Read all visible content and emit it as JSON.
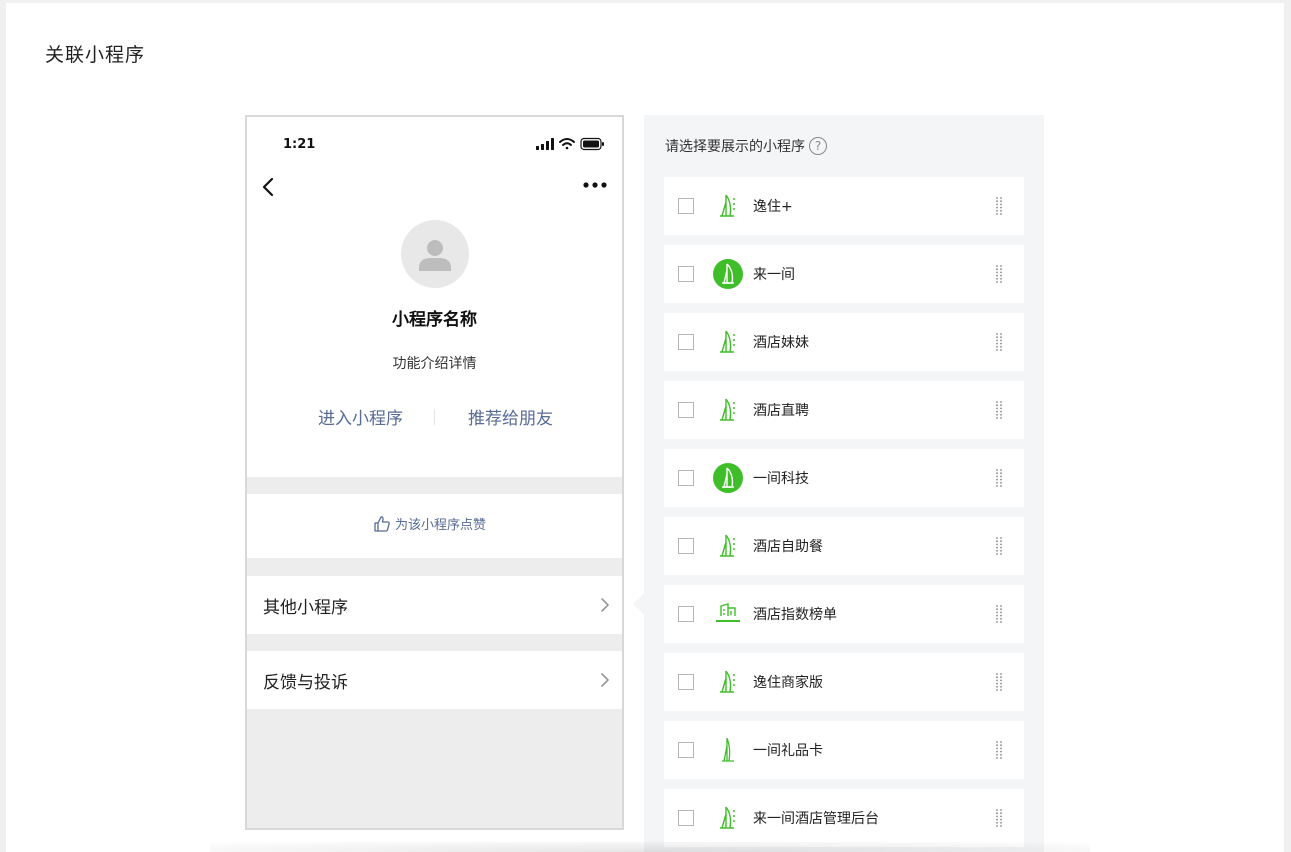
{
  "page": {
    "title": "关联小程序"
  },
  "phone": {
    "time": "1:21",
    "name": "小程序名称",
    "description": "功能介绍详情",
    "actions": {
      "enter": "进入小程序",
      "share": "推荐给朋友"
    },
    "like_label": "为该小程序点赞",
    "menu": [
      {
        "label": "其他小程序"
      },
      {
        "label": "反馈与投诉"
      }
    ]
  },
  "panel": {
    "title": "请选择要展示的小程序",
    "help_icon": "question-circle-icon",
    "items": [
      {
        "name": "逸住+",
        "logo": "tower-outline"
      },
      {
        "name": "来一间",
        "logo": "tower-circle"
      },
      {
        "name": "酒店妹妹",
        "logo": "tower-outline"
      },
      {
        "name": "酒店直聘",
        "logo": "tower-outline"
      },
      {
        "name": "一间科技",
        "logo": "tower-circle"
      },
      {
        "name": "酒店自助餐",
        "logo": "tower-outline"
      },
      {
        "name": "酒店指数榜单",
        "logo": "hotel-index"
      },
      {
        "name": "逸住商家版",
        "logo": "tower-outline"
      },
      {
        "name": "一间礼品卡",
        "logo": "tower-simple"
      },
      {
        "name": "来一间酒店管理后台",
        "logo": "tower-outline"
      }
    ]
  },
  "colors": {
    "accent_green": "#3fbe2a",
    "link_blue": "#576b95",
    "panel_bg": "#f4f5f7"
  }
}
